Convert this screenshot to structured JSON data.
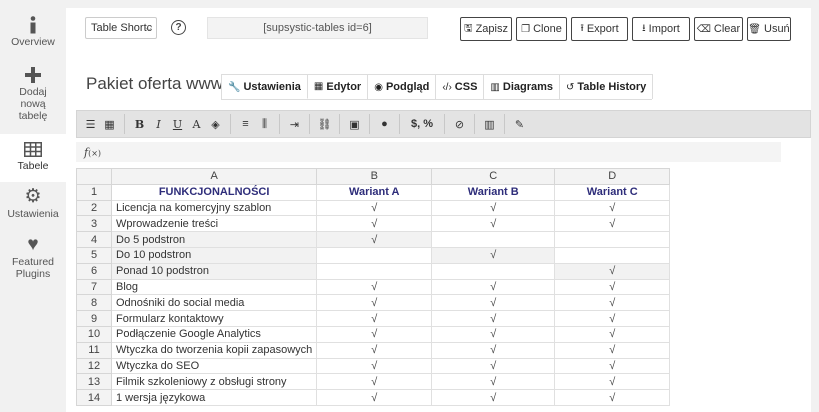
{
  "sidebar": {
    "items": [
      {
        "label": "Overview"
      },
      {
        "label": "Dodaj nową tabelę"
      },
      {
        "label": "Tabele"
      },
      {
        "label": "Ustawienia"
      },
      {
        "label": "Featured Plugins"
      }
    ]
  },
  "topbar": {
    "select_value": "Table Shortc",
    "shortcode": "[supsystic-tables id=6]",
    "buttons": {
      "save": "Zapisz",
      "clone": "Clone",
      "export": "Export",
      "import": "Import",
      "clear": "Clear",
      "delete": "Usuń"
    }
  },
  "page": {
    "title": "Pakiet oferta www",
    "tabs": [
      {
        "label": "Ustawienia"
      },
      {
        "label": "Edytor"
      },
      {
        "label": "Podgląd"
      },
      {
        "label": "CSS"
      },
      {
        "label": "Diagrams"
      },
      {
        "label": "Table History"
      }
    ]
  },
  "toolbar": {
    "currency_label": "$, %"
  },
  "formula": {
    "fx": "f",
    "fx_sub": "(×)"
  },
  "grid": {
    "columns": [
      "A",
      "B",
      "C",
      "D"
    ],
    "header_row": {
      "num": "1",
      "a": "FUNKCJONALNOŚCI",
      "b": "Wariant A",
      "c": "Wariant B",
      "d": "Wariant C"
    },
    "rows": [
      {
        "num": "2",
        "a": "Licencja na komercyjny szablon",
        "b": "√",
        "c": "√",
        "d": "√"
      },
      {
        "num": "3",
        "a": "Wprowadzenie treści",
        "b": "√",
        "c": "√",
        "d": "√"
      },
      {
        "num": "4",
        "a": "Do 5 podstron",
        "b": "√",
        "c": "",
        "d": ""
      },
      {
        "num": "5",
        "a": "Do 10 podstron",
        "b": "",
        "c": "√",
        "d": ""
      },
      {
        "num": "6",
        "a": "Ponad 10 podstron",
        "b": "",
        "c": "",
        "d": "√"
      },
      {
        "num": "7",
        "a": "Blog",
        "b": "√",
        "c": "√",
        "d": "√"
      },
      {
        "num": "8",
        "a": "Odnośniki do social media",
        "b": "√",
        "c": "√",
        "d": "√"
      },
      {
        "num": "9",
        "a": "Formularz kontaktowy",
        "b": "√",
        "c": "√",
        "d": "√"
      },
      {
        "num": "10",
        "a": "Podłączenie Google Analytics",
        "b": "√",
        "c": "√",
        "d": "√"
      },
      {
        "num": "11",
        "a": "Wtyczka do tworzenia kopii zapasowych",
        "b": "√",
        "c": "√",
        "d": "√"
      },
      {
        "num": "12",
        "a": "Wtyczka do SEO",
        "b": "√",
        "c": "√",
        "d": "√"
      },
      {
        "num": "13",
        "a": "Filmik szkoleniowy z obsługi strony",
        "b": "√",
        "c": "√",
        "d": "√"
      },
      {
        "num": "14",
        "a": "1 wersja językowa",
        "b": "√",
        "c": "√",
        "d": "√"
      }
    ]
  }
}
